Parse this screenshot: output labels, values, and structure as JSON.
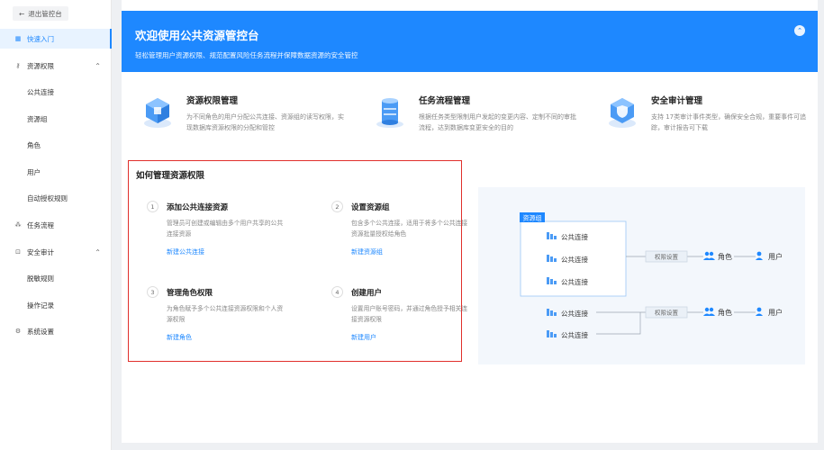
{
  "sidebar": {
    "exit_label": "退出管控台",
    "items": [
      {
        "label": "快速入门",
        "active": true,
        "icon": "grid-icon"
      },
      {
        "label": "资源权限",
        "expandable": true,
        "icon": "key-icon"
      },
      {
        "label": "公共连接",
        "sub": true
      },
      {
        "label": "资源组",
        "sub": true
      },
      {
        "label": "角色",
        "sub": true
      },
      {
        "label": "用户",
        "sub": true
      },
      {
        "label": "自动授权规则",
        "sub": true
      },
      {
        "label": "任务流程",
        "icon": "flow-icon"
      },
      {
        "label": "安全审计",
        "expandable": true,
        "icon": "audit-icon"
      },
      {
        "label": "脱敏规则",
        "sub": true
      },
      {
        "label": "操作记录",
        "sub": true
      },
      {
        "label": "系统设置",
        "icon": "gear-icon"
      }
    ]
  },
  "banner": {
    "title": "欢迎使用公共资源管控台",
    "subtitle": "轻松管理用户资源权限、规范配置风险任务流程并保障数据资源的安全管控"
  },
  "features": [
    {
      "title": "资源权限管理",
      "desc": "为不同角色的用户分配公共连接、资源组的读写权限，实现数据库资源权限的分配和管控",
      "icon": "cube-icon"
    },
    {
      "title": "任务流程管理",
      "desc": "根据任务类型限制用户发起的变更内容、定制不同的审批流程，达到数据库变更安全的目的",
      "icon": "database-icon"
    },
    {
      "title": "安全审计管理",
      "desc": "支持 17类审计事件类型，确保安全合规，重要事件可追踪，审计报告可下载",
      "icon": "shield-icon"
    }
  ],
  "howto": {
    "title": "如何管理资源权限",
    "steps": [
      {
        "num": "1",
        "title": "添加公共连接资源",
        "desc": "管理员可创建或编辑由多个用户共享的公共连接资源",
        "link": "新建公共连接"
      },
      {
        "num": "2",
        "title": "设置资源组",
        "desc": "包含多个公共连接，适用于将多个公共连接资源批量授权给角色",
        "link": "新建资源组"
      },
      {
        "num": "3",
        "title": "管理角色权限",
        "desc": "为角色赋予多个公共连接资源权限和个人资源权限",
        "link": "新建角色"
      },
      {
        "num": "4",
        "title": "创建用户",
        "desc": "设置用户账号密码，并通过角色授予相关连接资源权限",
        "link": "新建用户"
      }
    ]
  },
  "diagram": {
    "group_label": "资源组",
    "connection_label": "公共连接",
    "permission_label": "权限设置",
    "role_label": "角色",
    "user_label": "用户"
  },
  "colors": {
    "accent": "#1e88ff",
    "highlight": "#e0302c"
  }
}
